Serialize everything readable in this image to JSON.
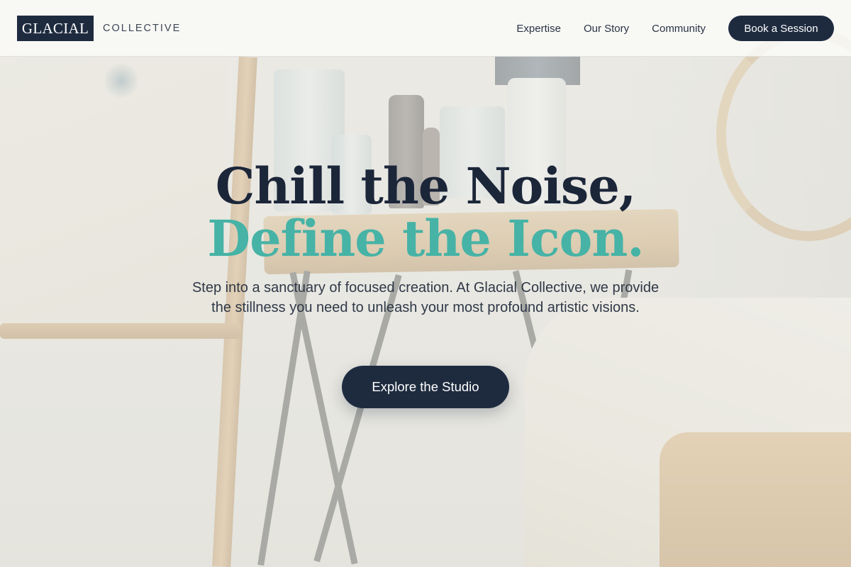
{
  "header": {
    "brand_main": "GLACIAL",
    "brand_sub": "COLLECTIVE",
    "nav": [
      "Expertise",
      "Our Story",
      "Community"
    ],
    "cta_label": "Book a Session"
  },
  "hero": {
    "headline_line1": "Chill the Noise,",
    "headline_line2": "Define the Icon.",
    "description": "Step into a sanctuary of focused creation. At Glacial Collective, we provide the stillness you need to unleash your most profound artistic visions.",
    "button_label": "Explore the Studio"
  },
  "colors": {
    "navy": "#1e2b3f",
    "teal_accent": "#46b3a6",
    "header_bg": "#fafaf8"
  }
}
